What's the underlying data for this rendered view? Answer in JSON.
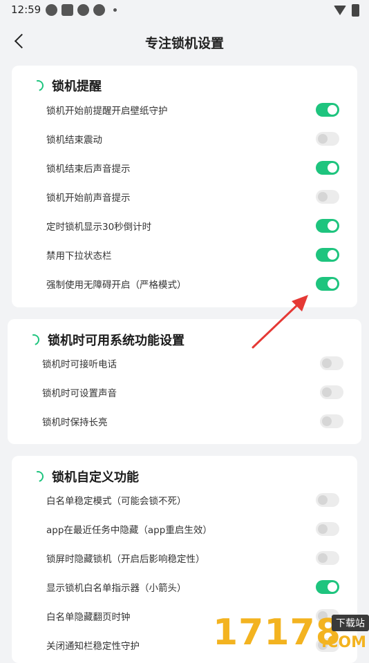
{
  "status_bar": {
    "time": "12:59"
  },
  "header": {
    "title": "专注锁机设置"
  },
  "sections": [
    {
      "title": "锁机提醒",
      "items": [
        {
          "label": "锁机开始前提醒开启壁纸守护",
          "on": true
        },
        {
          "label": "锁机结束震动",
          "on": false
        },
        {
          "label": "锁机结束后声音提示",
          "on": true
        },
        {
          "label": "锁机开始前声音提示",
          "on": false
        },
        {
          "label": "定时锁机显示30秒倒计时",
          "on": true
        },
        {
          "label": "禁用下拉状态栏",
          "on": true
        },
        {
          "label": "强制使用无障碍开启（严格模式）",
          "on": true
        }
      ]
    },
    {
      "title": "锁机时可用系统功能设置",
      "items": [
        {
          "label": "锁机时可接听电话",
          "on": false
        },
        {
          "label": "锁机时可设置声音",
          "on": false
        },
        {
          "label": "锁机时保持长亮",
          "on": false
        }
      ]
    },
    {
      "title": "锁机自定义功能",
      "items": [
        {
          "label": "白名单稳定模式（可能会锁不死）",
          "on": false
        },
        {
          "label": "app在最近任务中隐藏（app重启生效）",
          "on": false
        },
        {
          "label": "锁屏时隐藏锁机（开启后影响稳定性）",
          "on": false
        },
        {
          "label": "显示锁机白名单指示器（小箭头）",
          "on": true
        },
        {
          "label": "白名单隐藏翻页时钟",
          "on": false
        },
        {
          "label": "关闭通知栏稳定性守护",
          "on": false
        }
      ]
    }
  ],
  "watermark": {
    "number": "17178",
    "tag": "下载站",
    "domain": ".COM"
  },
  "colors": {
    "accent": "#1ec47e",
    "toggle_off": "#ececec",
    "arrow": "#e53935",
    "watermark": "#f3b320"
  }
}
